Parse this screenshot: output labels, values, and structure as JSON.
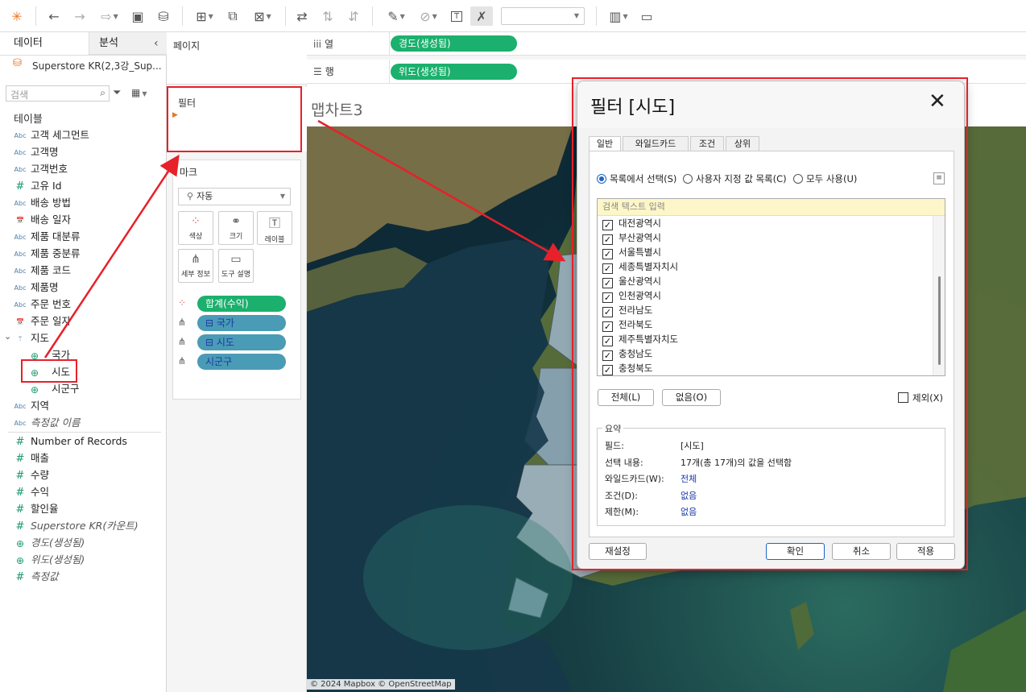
{
  "toolbar": {
    "icons": [
      "tableau-logo-icon",
      "undo-icon",
      "redo-icon",
      "replay-icon",
      "save-icon",
      "new-datasource-icon",
      "new-worksheet-icon",
      "duplicate-icon",
      "clear-icon",
      "swap-icon",
      "sort-asc-icon",
      "sort-desc-icon",
      "highlight-icon",
      "group-icon",
      "label-icon",
      "fix-axes-icon",
      "show-me-icon",
      "presentation-icon"
    ]
  },
  "datapane": {
    "tab_data": "데이터",
    "tab_analysis": "분석",
    "datasource": "Superstore KR(2,3강_Sup...",
    "search_placeholder": "검색",
    "tables_label": "테이블",
    "fields": [
      {
        "type": "Abc",
        "name": "고객 세그먼트"
      },
      {
        "type": "Abc",
        "name": "고객명"
      },
      {
        "type": "Abc",
        "name": "고객번호"
      },
      {
        "type": "#",
        "name": "고유 Id"
      },
      {
        "type": "Abc",
        "name": "배송 방법"
      },
      {
        "type": "date",
        "name": "배송 일자"
      },
      {
        "type": "Abc",
        "name": "제품 대분류"
      },
      {
        "type": "Abc",
        "name": "제품 중분류"
      },
      {
        "type": "Abc",
        "name": "제품 코드"
      },
      {
        "type": "Abc",
        "name": "제품명"
      },
      {
        "type": "Abc",
        "name": "주문 번호"
      },
      {
        "type": "date",
        "name": "주문 일자"
      },
      {
        "type": "hier",
        "name": "지도"
      },
      {
        "type": "geo",
        "name": "국가"
      },
      {
        "type": "geo",
        "name": "시도"
      },
      {
        "type": "geo",
        "name": "시군구"
      },
      {
        "type": "Abc",
        "name": "지역"
      },
      {
        "type": "Abc",
        "name": "측정값 이름"
      }
    ],
    "measures": [
      {
        "type": "#",
        "name": "Number of Records"
      },
      {
        "type": "#",
        "name": "매출"
      },
      {
        "type": "#",
        "name": "수량"
      },
      {
        "type": "#",
        "name": "수익"
      },
      {
        "type": "#",
        "name": "할인율"
      },
      {
        "type": "#",
        "name": "Superstore KR(카운트)"
      },
      {
        "type": "geo",
        "name": "경도(생성됨)"
      },
      {
        "type": "geo",
        "name": "위도(생성됨)"
      },
      {
        "type": "#",
        "name": "측정값"
      }
    ]
  },
  "midpane": {
    "pages_label": "페이지",
    "filters_label": "필터",
    "marks_label": "마크",
    "mark_type": "자동",
    "mark_buttons": [
      "색상",
      "크기",
      "레이블",
      "세부 정보",
      "도구 설명"
    ],
    "pills": [
      "합계(수익)",
      "국가",
      "시도",
      "시군구"
    ]
  },
  "shelves": {
    "columns_label": "열",
    "rows_label": "행",
    "columns_pill": "경도(생성됨)",
    "rows_pill": "위도(생성됨)"
  },
  "worksheet": {
    "title": "맵차트3",
    "attribution": "© 2024 Mapbox © OpenStreetMap"
  },
  "dialog": {
    "title": "필터 [시도]",
    "tabs": [
      "일반",
      "와일드카드",
      "조건",
      "상위"
    ],
    "radio_options": [
      "목록에서 선택(S)",
      "사용자 지정 값 목록(C)",
      "모두 사용(U)"
    ],
    "search_placeholder": "검색 텍스트 입력",
    "items": [
      "대전광역시",
      "부산광역시",
      "서울특별시",
      "세종특별자치시",
      "울산광역시",
      "인천광역시",
      "전라남도",
      "전라북도",
      "제주특별자치도",
      "충청남도",
      "충청북도"
    ],
    "btn_all": "전체(L)",
    "btn_none": "없음(O)",
    "exclude_label": "제외(X)",
    "summary_title": "요약",
    "summary": [
      {
        "k": "필드:",
        "v": "[시도]"
      },
      {
        "k": "선택 내용:",
        "v": "17개(총 17개)의 값을 선택함"
      },
      {
        "k": "와일드카드(W):",
        "v": "전체"
      },
      {
        "k": "조건(D):",
        "v": "없음"
      },
      {
        "k": "제한(M):",
        "v": "없음"
      }
    ],
    "btn_reset": "재설정",
    "btn_ok": "확인",
    "btn_cancel": "취소",
    "btn_apply": "적용"
  },
  "colors": {
    "pill_green": "#1bb06d",
    "pill_blue": "#4a9bb5",
    "highlight_red": "#e8202a"
  }
}
